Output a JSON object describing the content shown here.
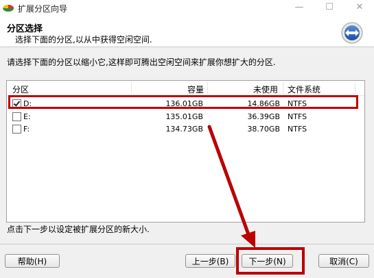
{
  "window": {
    "title": "扩展分区向导",
    "minimize": "—",
    "maximize": "☐",
    "close": "✕"
  },
  "header": {
    "title": "分区选择",
    "subtitle": "选择下面的分区,以从中获得空闲空间."
  },
  "instruction": "请选择下面的分区以缩小它,这样即可腾出空闲空间来扩展你想扩大的分区.",
  "table": {
    "columns": [
      "分区",
      "容量",
      "未使用",
      "文件系统"
    ],
    "rows": [
      {
        "name": "D:",
        "capacity": "136.01GB",
        "unused": "14.86GB",
        "fs": "NTFS",
        "checked": true
      },
      {
        "name": "E:",
        "capacity": "135.01GB",
        "unused": "36.39GB",
        "fs": "NTFS",
        "checked": false
      },
      {
        "name": "F:",
        "capacity": "134.73GB",
        "unused": "38.70GB",
        "fs": "NTFS",
        "checked": false
      }
    ]
  },
  "footer": {
    "text": "点击下一步以设定被扩展分区的新大小."
  },
  "buttons": {
    "help": "帮助(H)",
    "back": "上一步(B)",
    "next": "下一步(N)",
    "cancel": "取消(C)"
  },
  "colors": {
    "annotation": "#b00000",
    "header_bg": "#ffffff",
    "dialog_bg": "#f0f0f0"
  },
  "icons": {
    "app": "partition-app-icon",
    "header": "expand-arrows-icon"
  }
}
